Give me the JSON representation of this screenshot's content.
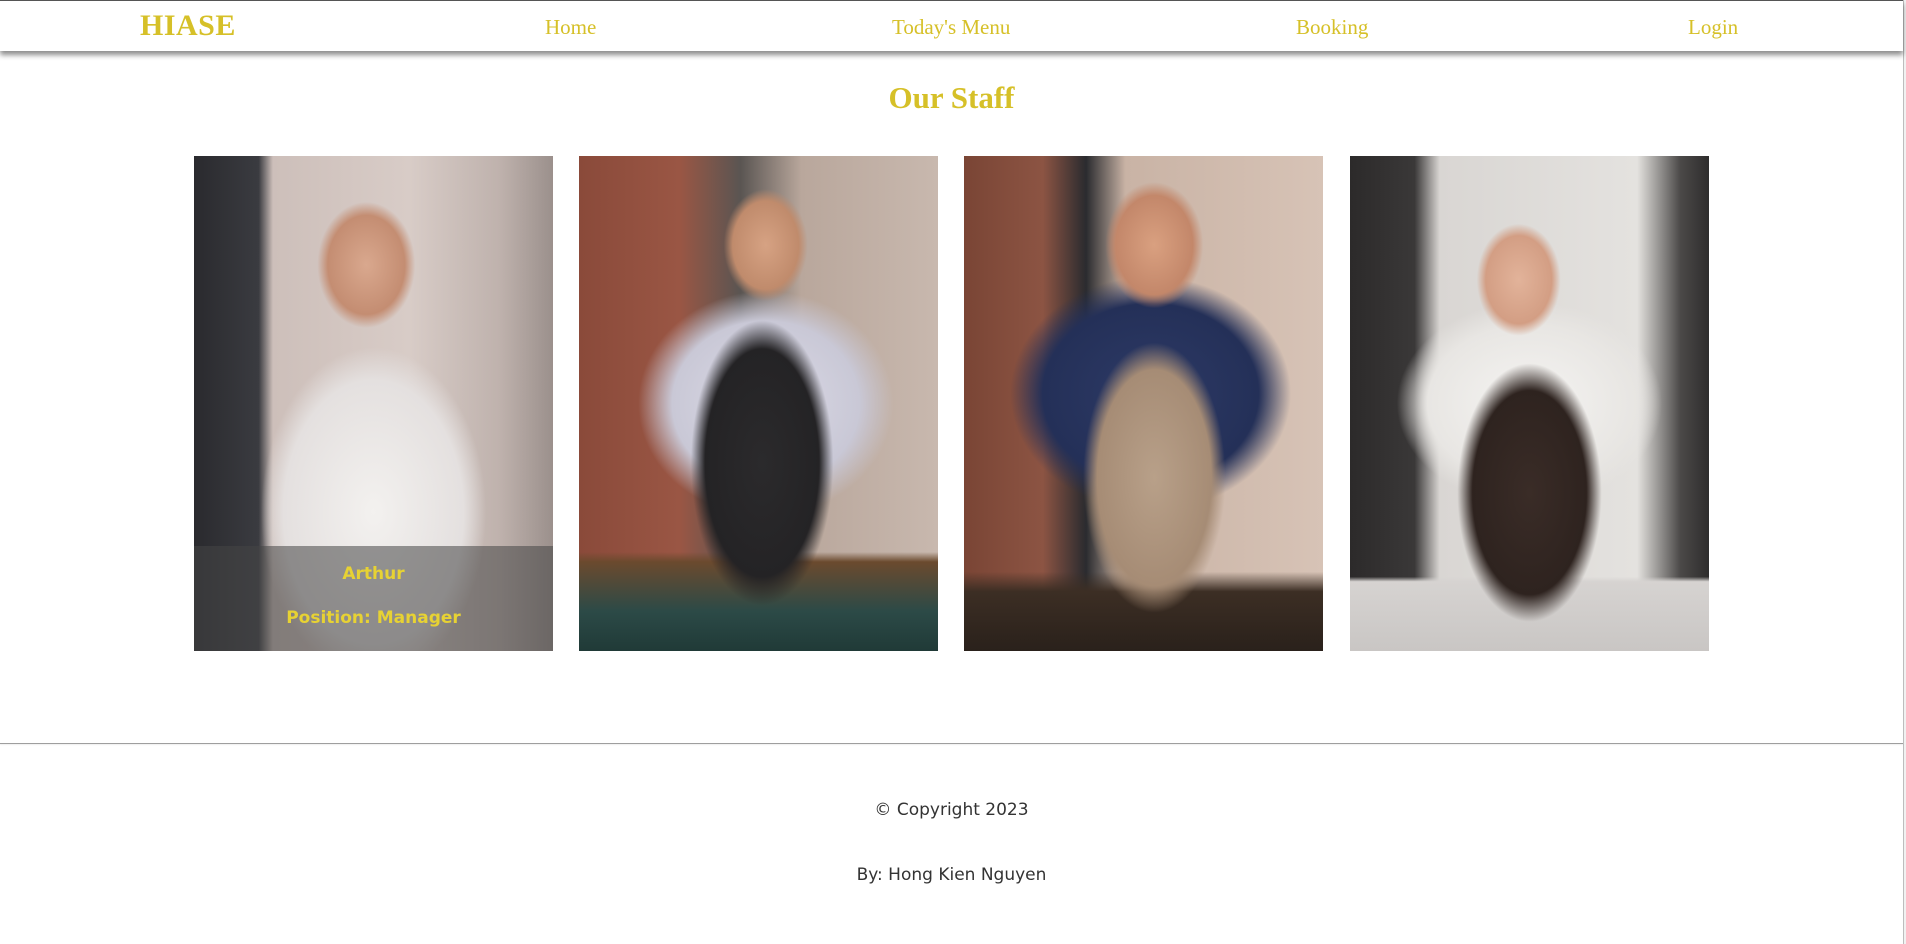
{
  "navbar": {
    "brand": "HIASE",
    "links": [
      {
        "label": "Home"
      },
      {
        "label": "Today's Menu"
      },
      {
        "label": "Booking"
      },
      {
        "label": "Login"
      }
    ]
  },
  "staff_section": {
    "title": "Our Staff",
    "cards": [
      {
        "photo": "barista-man-white-shirt-photo",
        "name": "Arthur",
        "position": "Position: Manager"
      },
      {
        "photo": "barista-man-black-apron-photo"
      },
      {
        "photo": "barista-man-tan-apron-photo"
      },
      {
        "photo": "barista-woman-dark-apron-photo"
      }
    ]
  },
  "footer": {
    "copyright": "© Copyright 2023",
    "author": "By: Hong Kien Nguyen"
  },
  "colors": {
    "accent": "#d6c028",
    "footer_text": "#333333",
    "background": "#ffffff"
  }
}
